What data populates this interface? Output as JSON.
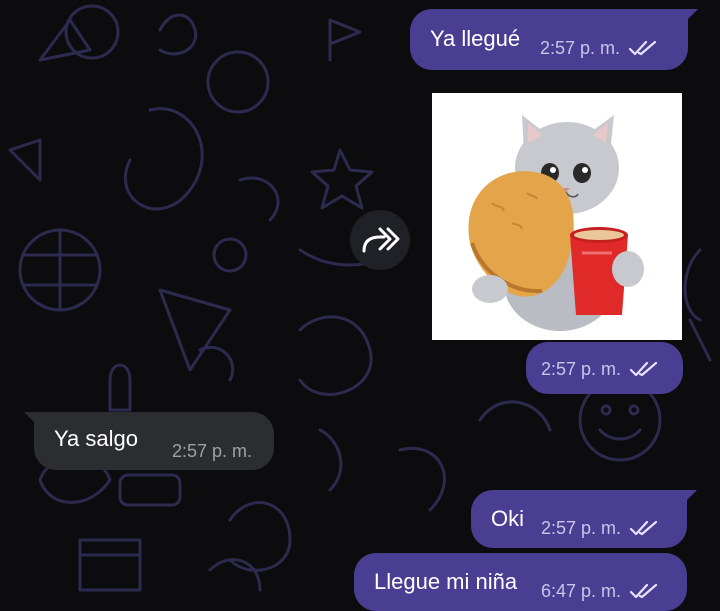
{
  "messages": [
    {
      "text": "Ya llegué",
      "time": "2:57 p. m."
    },
    {
      "time": "2:57 p. m."
    },
    {
      "text": "Ya salgo",
      "time": "2:57 p. m."
    },
    {
      "text": "Oki",
      "time": "2:57 p. m."
    },
    {
      "text": "Llegue mi niña",
      "time": "6:47 p. m."
    }
  ],
  "icons": {
    "read_receipt": "double-check-icon",
    "forward": "forward-arrow-icon",
    "sticker": "cat-sticker"
  },
  "colors": {
    "outgoing_bubble": "#4a3e93",
    "incoming_bubble": "#2b2d30",
    "background": "#0c0c0f",
    "doodle": "#2c2a4e"
  }
}
